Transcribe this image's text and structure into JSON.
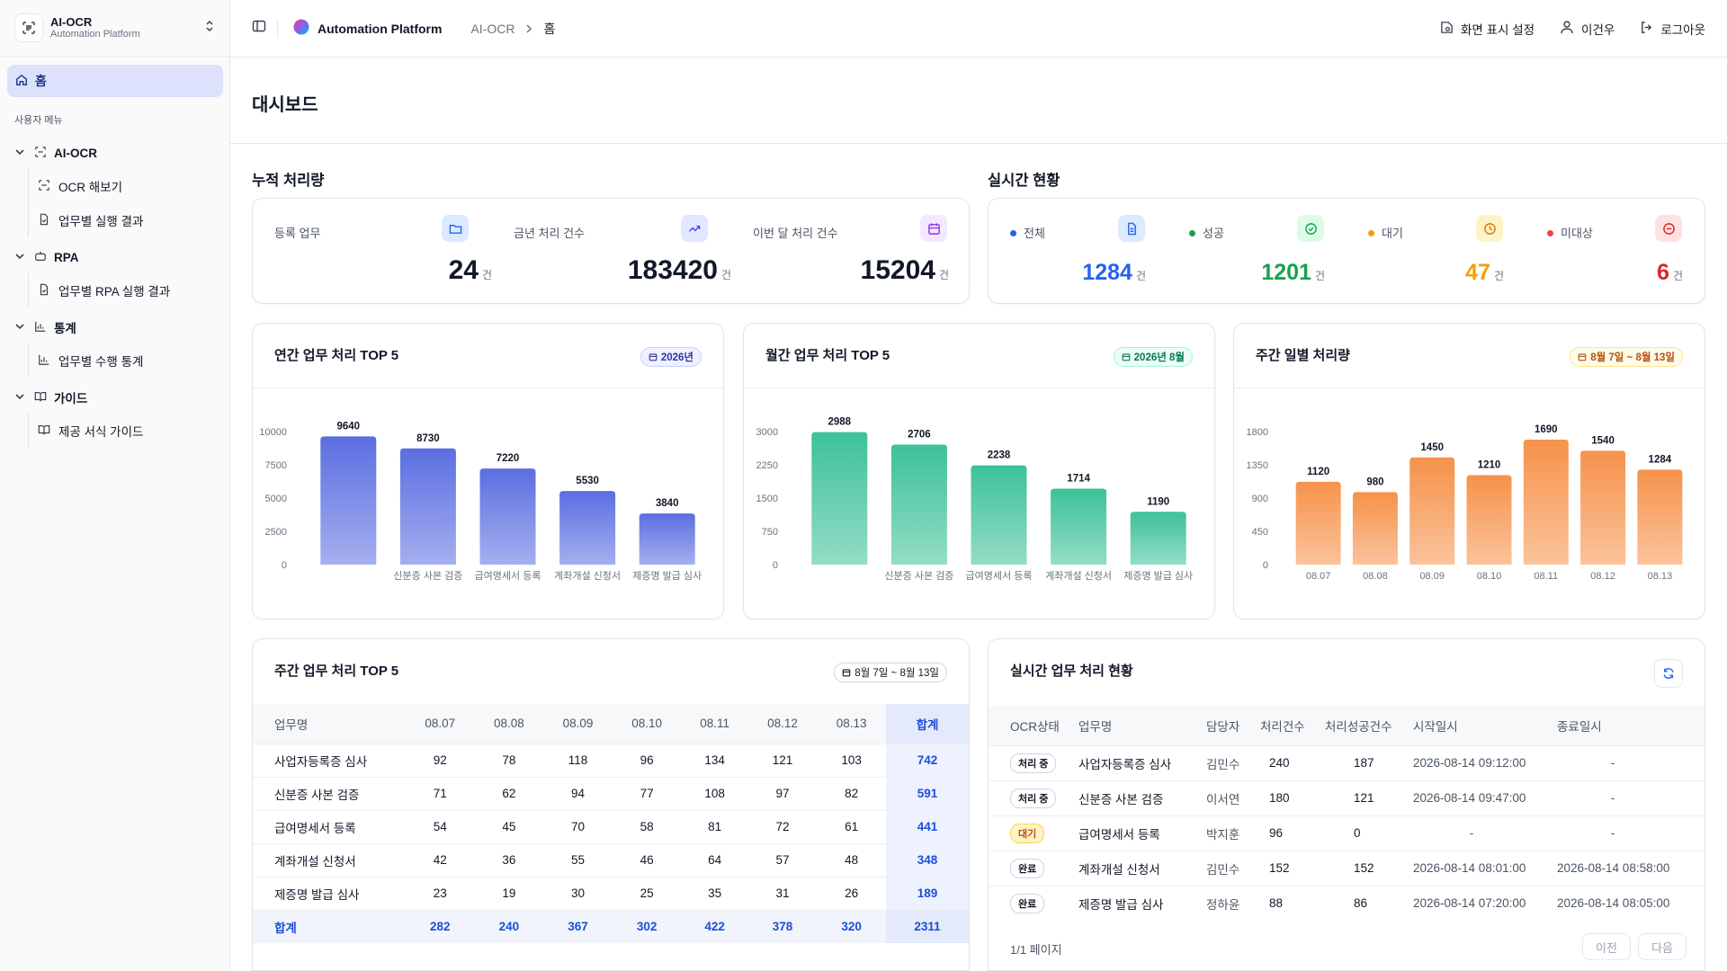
{
  "brand": {
    "title": "AI-OCR",
    "subtitle": "Automation Platform"
  },
  "sidebar": {
    "home_label": "홈",
    "menu_heading": "사용자 메뉴",
    "groups": [
      {
        "label": "AI-OCR",
        "items": [
          "OCR 해보기",
          "업무별 실행 결과"
        ]
      },
      {
        "label": "RPA",
        "items": [
          "업무별 RPA 실행 결과"
        ]
      },
      {
        "label": "통계",
        "items": [
          "업무별 수행 통계"
        ]
      },
      {
        "label": "가이드",
        "items": [
          "제공 서식 가이드"
        ]
      }
    ]
  },
  "topbar": {
    "app": "Automation Platform",
    "crumb_mid": "AI-OCR",
    "crumb_current": "홈",
    "display_settings": "화면 표시 설정",
    "user": "이건우",
    "logout": "로그아웃"
  },
  "page": {
    "title": "대시보드"
  },
  "cumulative": {
    "title": "누적 처리량",
    "unit": "건",
    "stats": [
      {
        "label": "등록 업무",
        "value": "24"
      },
      {
        "label": "금년 처리 건수",
        "value": "183420"
      },
      {
        "label": "이번 달 처리 건수",
        "value": "15204"
      }
    ]
  },
  "realtime": {
    "title": "실시간 현황",
    "unit": "건",
    "stats": [
      {
        "label": "전체",
        "value": "1284",
        "color": "#2563eb"
      },
      {
        "label": "성공",
        "value": "1201",
        "color": "#16a34a"
      },
      {
        "label": "대기",
        "value": "47",
        "color": "#f59e0b"
      },
      {
        "label": "미대상",
        "value": "6",
        "color": "#dc2626"
      }
    ]
  },
  "chart_data": [
    {
      "type": "bar",
      "title": "연간 업무 처리 TOP 5",
      "badge": "2026년",
      "categories": [
        "사업자등록증 심사",
        "신분증 사본 검증",
        "급여명세서 등록",
        "계좌개설 신청서",
        "제증명 발급 심사"
      ],
      "visible_category_labels": [
        "",
        "신분증 사본 검증",
        "급여명세서 등록",
        "계좌개설 신청서",
        "제증명 발급 심사"
      ],
      "values": [
        9640,
        8730,
        7220,
        5530,
        3840
      ],
      "ylim": [
        0,
        10000
      ],
      "yticks": [
        0,
        2500,
        5000,
        7500,
        10000
      ],
      "color": "#5b6ee1"
    },
    {
      "type": "bar",
      "title": "월간 업무 처리 TOP 5",
      "badge": "2026년 8월",
      "categories": [
        "사업자등록증 심사",
        "신분증 사본 검증",
        "급여명세서 등록",
        "계좌개설 신청서",
        "제증명 발급 심사"
      ],
      "visible_category_labels": [
        "",
        "신분증 사본 검증",
        "급여명세서 등록",
        "계좌개설 신청서",
        "제증명 발급 심사"
      ],
      "values": [
        2988,
        2706,
        2238,
        1714,
        1190
      ],
      "ylim": [
        0,
        3000
      ],
      "yticks": [
        0,
        750,
        1500,
        2250,
        3000
      ],
      "color": "#3cc198"
    },
    {
      "type": "bar",
      "title": "주간 일별 처리량",
      "badge": "8월 7일 ~ 8월 13일",
      "categories": [
        "08.07",
        "08.08",
        "08.09",
        "08.10",
        "08.11",
        "08.12",
        "08.13"
      ],
      "visible_category_labels": [
        "08.07",
        "08.08",
        "08.09",
        "08.10",
        "08.11",
        "08.12",
        "08.13"
      ],
      "values": [
        1120,
        980,
        1450,
        1210,
        1690,
        1540,
        1284
      ],
      "ylim": [
        0,
        1800
      ],
      "yticks": [
        0,
        450,
        900,
        1350,
        1800
      ],
      "color": "#f6924a"
    }
  ],
  "weekly_table": {
    "title": "주간 업무 처리 TOP 5",
    "badge": "8월 7일 ~ 8월 13일",
    "headers": [
      "업무명",
      "08.07",
      "08.08",
      "08.09",
      "08.10",
      "08.11",
      "08.12",
      "08.13",
      "합계"
    ],
    "rows": [
      [
        "사업자등록증 심사",
        "92",
        "78",
        "118",
        "96",
        "134",
        "121",
        "103",
        "742"
      ],
      [
        "신분증 사본 검증",
        "71",
        "62",
        "94",
        "77",
        "108",
        "97",
        "82",
        "591"
      ],
      [
        "급여명세서 등록",
        "54",
        "45",
        "70",
        "58",
        "81",
        "72",
        "61",
        "441"
      ],
      [
        "계좌개설 신청서",
        "42",
        "36",
        "55",
        "46",
        "64",
        "57",
        "48",
        "348"
      ],
      [
        "제증명 발급 심사",
        "23",
        "19",
        "30",
        "25",
        "35",
        "31",
        "26",
        "189"
      ]
    ],
    "total_row": [
      "합계",
      "282",
      "240",
      "367",
      "302",
      "422",
      "378",
      "320",
      "2311"
    ]
  },
  "realtime_table": {
    "title": "실시간 업무 처리 현황",
    "headers": [
      "OCR상태",
      "업무명",
      "담당자",
      "처리건수",
      "처리성공건수",
      "시작일시",
      "종료일시"
    ],
    "rows": [
      [
        "처리 중",
        "사업자등록증 심사",
        "김민수",
        "240",
        "187",
        "2026-08-14 09:12:00",
        "-"
      ],
      [
        "처리 중",
        "신분증 사본 검증",
        "이서연",
        "180",
        "121",
        "2026-08-14 09:47:00",
        "-"
      ],
      [
        "대기",
        "급여명세서 등록",
        "박지훈",
        "96",
        "0",
        "-",
        "-"
      ],
      [
        "완료",
        "계좌개설 신청서",
        "김민수",
        "152",
        "152",
        "2026-08-14 08:01:00",
        "2026-08-14 08:58:00"
      ],
      [
        "완료",
        "제증명 발급 심사",
        "정하윤",
        "88",
        "86",
        "2026-08-14 07:20:00",
        "2026-08-14 08:05:00"
      ]
    ],
    "page_info": "1/1 페이지",
    "prev": "이전",
    "next": "다음"
  }
}
